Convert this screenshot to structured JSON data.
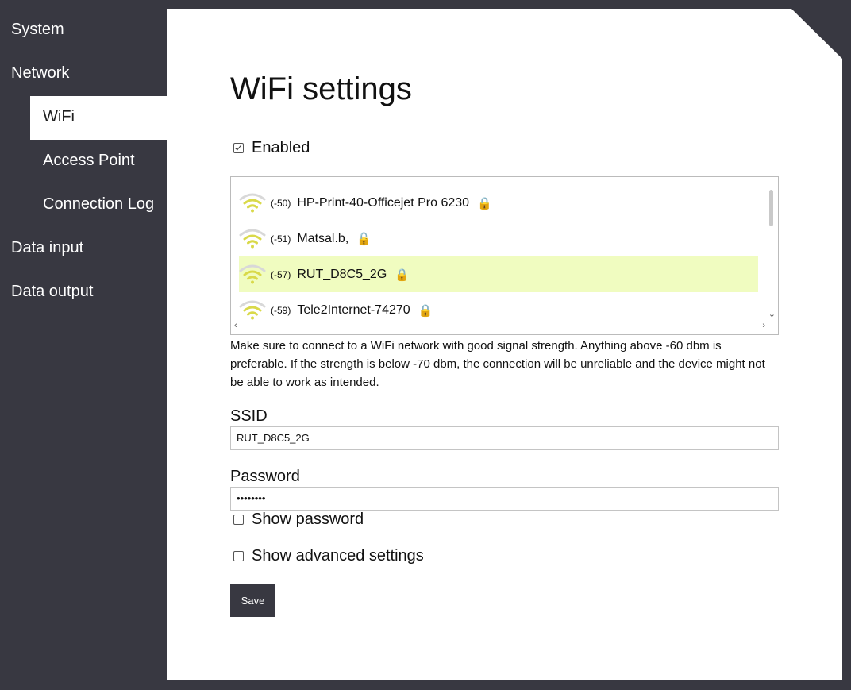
{
  "sidebar": {
    "items": [
      {
        "label": "System"
      },
      {
        "label": "Network"
      },
      {
        "label": "WiFi"
      },
      {
        "label": "Access Point"
      },
      {
        "label": "Connection Log"
      },
      {
        "label": "Data input"
      },
      {
        "label": "Data output"
      }
    ],
    "active": "WiFi"
  },
  "page": {
    "title": "WiFi settings",
    "enabled_label": "Enabled",
    "enabled_checked": true
  },
  "networks": [
    {
      "signal": "(-50)",
      "ssid": "HP-Print-40-Officejet Pro 6230",
      "icon": "lock-icon",
      "selected": false
    },
    {
      "signal": "(-51)",
      "ssid": "Matsal.b,",
      "icon": "unlock-icon",
      "selected": false
    },
    {
      "signal": "(-57)",
      "ssid": "RUT_D8C5_2G",
      "icon": "lock-icon",
      "selected": true
    },
    {
      "signal": "(-59)",
      "ssid": "Tele2Internet-74270",
      "icon": "lock-icon",
      "selected": false
    }
  ],
  "help_text": "Make sure to connect to a WiFi network with good signal strength. Anything above -60 dbm is preferable. If the strength is below -70 dbm, the connection will be unreliable and the device might not be able to work as intended.",
  "form": {
    "ssid_label": "SSID",
    "ssid_value": "RUT_D8C5_2G",
    "password_label": "Password",
    "password_value": "••••••••",
    "show_password_label": "Show password",
    "show_advanced_label": "Show advanced settings",
    "save_label": "Save"
  },
  "colors": {
    "background": "#383841",
    "selected_row": "#f0fcc0",
    "wifi_active": "#d9d94a",
    "wifi_inactive": "#d8d8d8"
  }
}
